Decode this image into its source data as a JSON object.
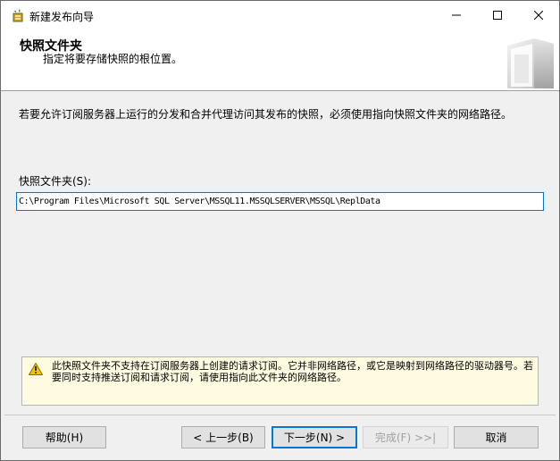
{
  "window": {
    "title": "新建发布向导",
    "minimize_icon": "minimize-icon",
    "maximize_icon": "maximize-icon",
    "close_icon": "close-icon"
  },
  "header": {
    "title": "快照文件夹",
    "subtitle": "指定将要存储快照的根位置。"
  },
  "main": {
    "description": "若要允许订阅服务器上运行的分发和合并代理访问其发布的快照，必须使用指向快照文件夹的网络路径。",
    "field_label": "快照文件夹(S):",
    "path_value": "C:\\Program Files\\Microsoft SQL Server\\MSSQL11.MSSQLSERVER\\MSSQL\\ReplData"
  },
  "warning": {
    "icon": "warning-icon",
    "text": "此快照文件夹不支持在订阅服务器上创建的请求订阅。它并非网络路径，或它是映射到网络路径的驱动器号。若要同时支持推送订阅和请求订阅，请使用指向此文件夹的网络路径。"
  },
  "buttons": {
    "help": "帮助(H)",
    "back": "< 上一步(B)",
    "next": "下一步(N) >",
    "finish": "完成(F) >>|",
    "cancel": "取消"
  },
  "colors": {
    "accent": "#0078d7",
    "warning_bg": "#fffbe1",
    "header_bg": "#ffffff",
    "dialog_bg": "#f0f0f0"
  }
}
